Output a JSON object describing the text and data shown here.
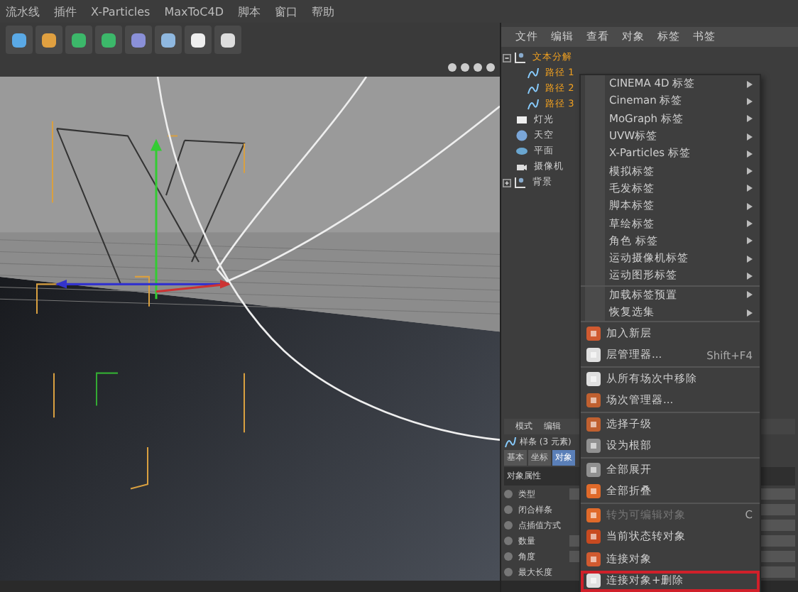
{
  "menubar": [
    "流水线",
    "插件",
    "X-Particles",
    "MaxToC4D",
    "脚本",
    "窗口",
    "帮助"
  ],
  "object_manager": {
    "menu": [
      "文件",
      "编辑",
      "查看",
      "对象",
      "标签",
      "书签"
    ],
    "tree": [
      {
        "label": "文本分解",
        "kind": "group",
        "selected": true,
        "expanded": true,
        "children": [
          {
            "label": "路径 1",
            "kind": "spline",
            "selected": true
          },
          {
            "label": "路径 2",
            "kind": "spline",
            "selected": true
          },
          {
            "label": "路径 3",
            "kind": "spline",
            "selected": true
          }
        ]
      },
      {
        "label": "灯光",
        "kind": "light",
        "selected": false
      },
      {
        "label": "天空",
        "kind": "sky",
        "selected": false
      },
      {
        "label": "平面",
        "kind": "plane",
        "selected": false
      },
      {
        "label": "摄像机",
        "kind": "camera",
        "selected": false
      },
      {
        "label": "背景",
        "kind": "group",
        "selected": false,
        "expanded": false
      }
    ]
  },
  "attributes": {
    "menu": [
      "模式",
      "编辑"
    ],
    "object": "样条 (3 元素)",
    "tabs": [
      {
        "label": "基本",
        "selected": false
      },
      {
        "label": "坐标",
        "selected": false
      },
      {
        "label": "对象",
        "selected": true
      }
    ],
    "section": "对象属性",
    "fields": [
      "类型",
      "闭合样条",
      "点插值方式",
      "数量",
      "角度",
      "最大长度"
    ]
  },
  "context_menu": {
    "groups": [
      [
        {
          "label": "CINEMA 4D 标签",
          "kind": "submenu"
        },
        {
          "label": "Cineman 标签",
          "kind": "submenu"
        },
        {
          "label": "MoGraph 标签",
          "kind": "submenu"
        },
        {
          "label": "UVW标签",
          "kind": "submenu"
        },
        {
          "label": "X-Particles 标签",
          "kind": "submenu"
        },
        {
          "label": "模拟标签",
          "kind": "submenu"
        },
        {
          "label": "毛发标签",
          "kind": "submenu"
        },
        {
          "label": "脚本标签",
          "kind": "submenu"
        },
        {
          "label": "草绘标签",
          "kind": "submenu"
        },
        {
          "label": "角色 标签",
          "kind": "submenu"
        },
        {
          "label": "运动摄像机标签",
          "kind": "submenu"
        },
        {
          "label": "运动图形标签",
          "kind": "submenu"
        }
      ],
      [
        {
          "label": "加载标签预置",
          "kind": "submenu"
        },
        {
          "label": "恢复选集",
          "kind": "submenu"
        }
      ],
      [
        {
          "label": "加入新层",
          "kind": "action",
          "disabled": false,
          "highlighted": false
        },
        {
          "label": "层管理器...",
          "kind": "action",
          "shortcut": "Shift+F4",
          "disabled": false,
          "highlighted": false
        }
      ],
      [
        {
          "label": "从所有场次中移除",
          "kind": "action",
          "disabled": false,
          "highlighted": false
        },
        {
          "label": "场次管理器...",
          "kind": "action",
          "disabled": false,
          "highlighted": false
        }
      ],
      [
        {
          "label": "选择子级",
          "kind": "action",
          "disabled": false,
          "highlighted": false
        },
        {
          "label": "设为根部",
          "kind": "action",
          "disabled": false,
          "highlighted": false
        }
      ],
      [
        {
          "label": "全部展开",
          "kind": "action",
          "disabled": false,
          "highlighted": false
        },
        {
          "label": "全部折叠",
          "kind": "action",
          "disabled": false,
          "highlighted": false
        }
      ],
      [
        {
          "label": "转为可编辑对象",
          "kind": "action",
          "shortcut": "C",
          "disabled": true,
          "highlighted": false
        },
        {
          "label": "当前状态转对象",
          "kind": "action",
          "disabled": false,
          "highlighted": false
        },
        {
          "label": "连接对象",
          "kind": "action",
          "disabled": false,
          "highlighted": false
        },
        {
          "label": "连接对象+删除",
          "kind": "action",
          "disabled": false,
          "highlighted": true
        }
      ]
    ]
  }
}
